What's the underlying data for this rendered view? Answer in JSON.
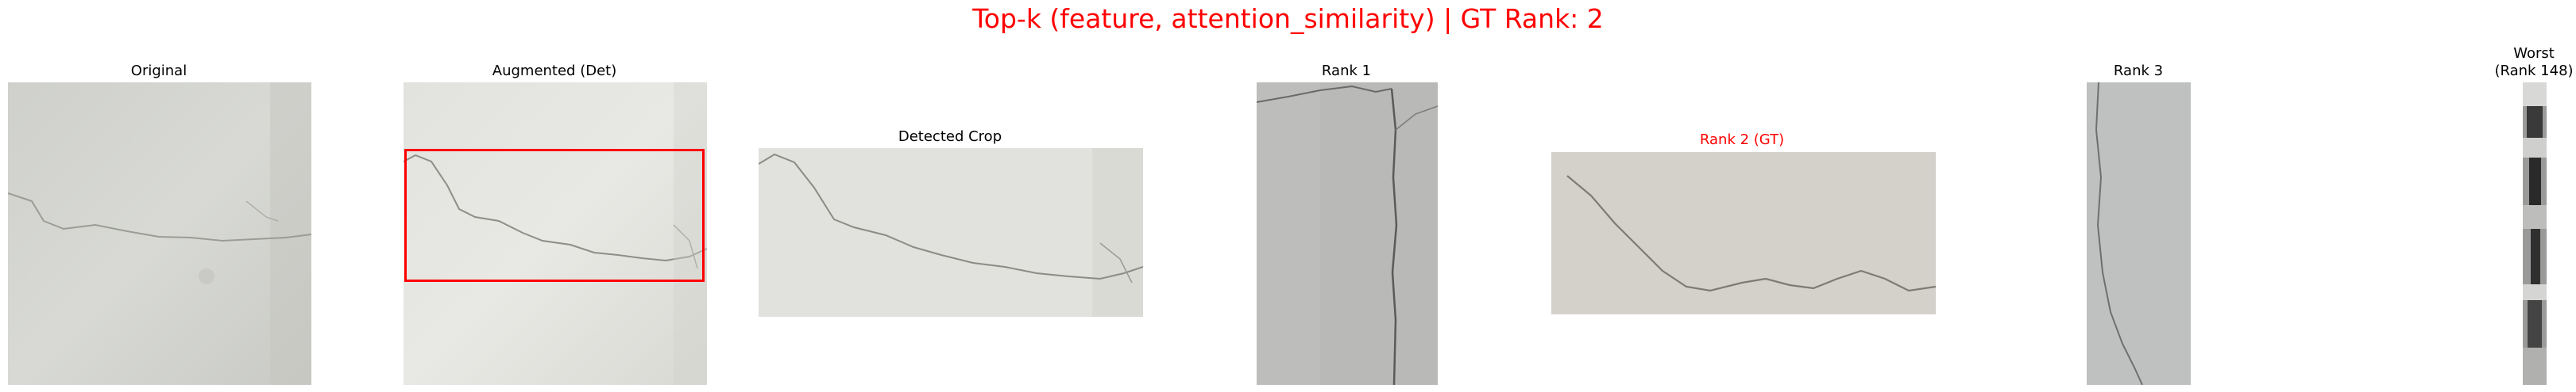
{
  "figure": {
    "suptitle": "Top-k (feature, attention_similarity) | GT Rank: 2",
    "panels": [
      {
        "id": "original",
        "title": "Original",
        "texture": "concrete-crack-diagonal"
      },
      {
        "id": "augmented",
        "title": "Augmented (Det)",
        "texture": "concrete-crack-diagonal-bright",
        "has_detection_box": true
      },
      {
        "id": "detected_crop",
        "title": "Detected Crop",
        "texture": "concrete-crack-crop"
      },
      {
        "id": "rank1",
        "title": "Rank 1",
        "texture": "concrete-crack-vertical"
      },
      {
        "id": "rank2",
        "title": "Rank 2 (GT)",
        "texture": "concrete-crack-wavy",
        "highlight_color": "#ff0000"
      },
      {
        "id": "rank3",
        "title": "Rank 3",
        "texture": "concrete-crack-vertical-narrow"
      },
      {
        "id": "worst",
        "title_line1": "Worst",
        "title_line2": "(Rank 148)",
        "texture": "dark-vertical-strip"
      }
    ],
    "colors": {
      "title": "#ff0000",
      "box": "#ff0000",
      "text": "#000000"
    }
  }
}
